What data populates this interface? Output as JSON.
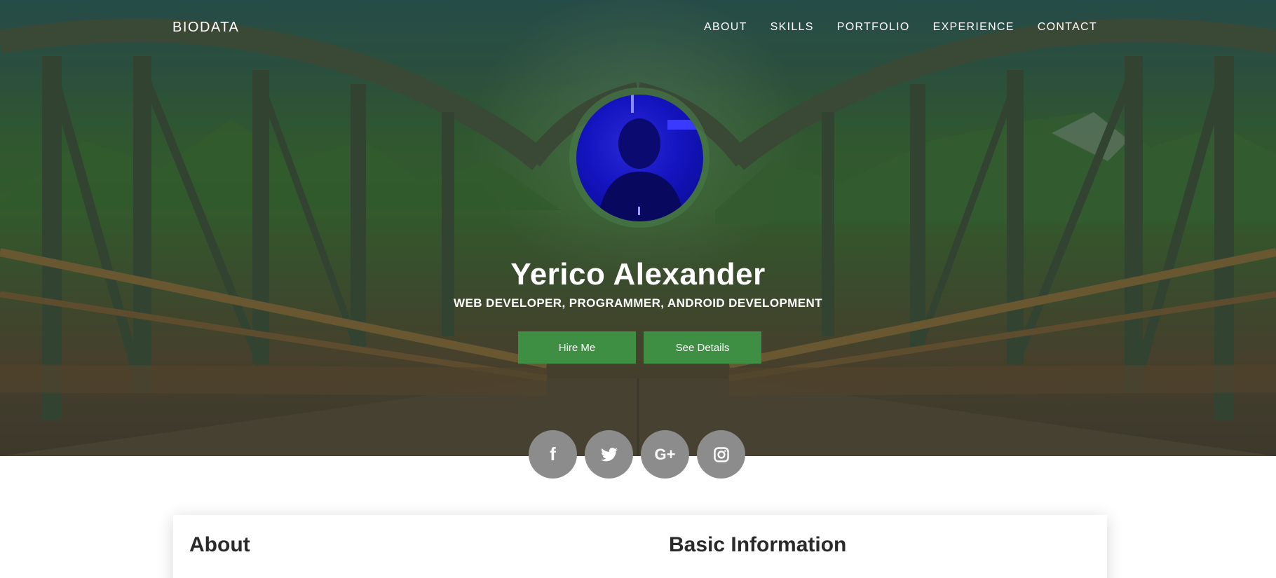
{
  "navbar": {
    "brand": "BIODATA",
    "links": [
      "ABOUT",
      "SKILLS",
      "PORTFOLIO",
      "EXPERIENCE",
      "CONTACT"
    ]
  },
  "hero": {
    "name": "Yerico Alexander",
    "subtitle": "WEB DEVELOPER, PROGRAMMER, ANDROID DEVELOPMENT",
    "hire_label": "Hire Me",
    "details_label": "See Details"
  },
  "social": {
    "facebook": "f",
    "twitter": "twitter-icon",
    "googleplus": "G+",
    "instagram": "instagram-icon"
  },
  "card": {
    "about_title": "About",
    "basic_title": "Basic Information"
  },
  "colors": {
    "accent_button": "#3e8f44",
    "social_circle": "#8c8c8c",
    "avatar_blue": "#1414c0"
  }
}
